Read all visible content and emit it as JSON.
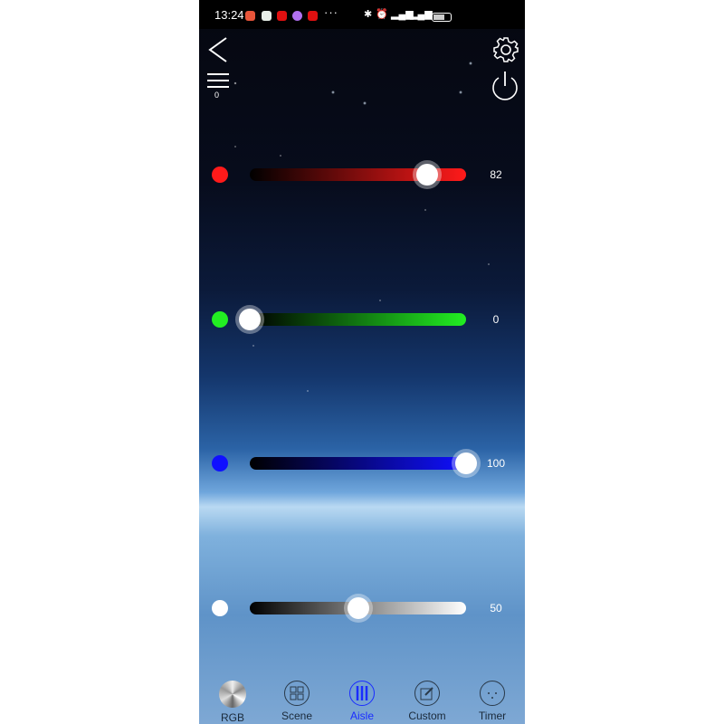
{
  "status_bar": {
    "time": "13:24",
    "more": "···"
  },
  "header": {
    "back": "back",
    "menu_badge": "0",
    "settings": "settings",
    "power": "power"
  },
  "sliders": [
    {
      "name": "red",
      "color": "#ff1a1a",
      "value": 82,
      "gradient": [
        "#000000",
        "#ff1a1a"
      ]
    },
    {
      "name": "green",
      "color": "#22ee22",
      "value": 0,
      "gradient": [
        "#000000",
        "#22ee22"
      ]
    },
    {
      "name": "blue",
      "color": "#1010ff",
      "value": 100,
      "gradient": [
        "#000000",
        "#1010ff"
      ]
    },
    {
      "name": "white",
      "color": "#ffffff",
      "value": 50,
      "gradient": [
        "#000000",
        "#ffffff"
      ]
    }
  ],
  "nav": {
    "active": "Aisle",
    "active_color": "#1a2cff",
    "tabs": [
      {
        "label": "RGB",
        "icon": "rgb-disc-icon"
      },
      {
        "label": "Scene",
        "icon": "grid-icon"
      },
      {
        "label": "Aisle",
        "icon": "sliders-icon"
      },
      {
        "label": "Custom",
        "icon": "edit-icon"
      },
      {
        "label": "Timer",
        "icon": "timer-icon"
      }
    ]
  }
}
